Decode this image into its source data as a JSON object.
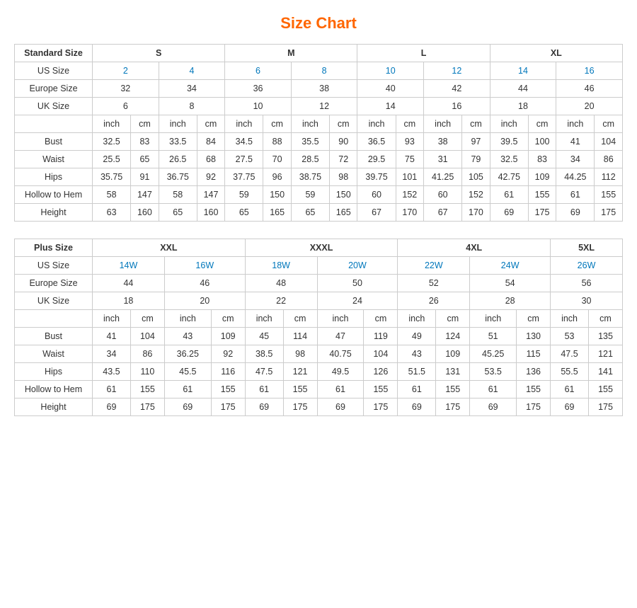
{
  "title": "Size Chart",
  "standard": {
    "section_title": "Standard Size",
    "sizes": [
      "S",
      "M",
      "L",
      "XL"
    ],
    "us_size_label": "US Size",
    "europe_size_label": "Europe Size",
    "uk_size_label": "UK Size",
    "us_sizes": [
      "2",
      "4",
      "6",
      "8",
      "10",
      "12",
      "14",
      "16"
    ],
    "europe_sizes": [
      "32",
      "34",
      "36",
      "38",
      "40",
      "42",
      "44",
      "46"
    ],
    "uk_sizes": [
      "6",
      "8",
      "10",
      "12",
      "14",
      "16",
      "18",
      "20"
    ],
    "inch_label": "inch",
    "cm_label": "cm",
    "measurements": [
      {
        "label": "Bust",
        "values": [
          "32.5",
          "83",
          "33.5",
          "84",
          "34.5",
          "88",
          "35.5",
          "90",
          "36.5",
          "93",
          "38",
          "97",
          "39.5",
          "100",
          "41",
          "104"
        ]
      },
      {
        "label": "Waist",
        "values": [
          "25.5",
          "65",
          "26.5",
          "68",
          "27.5",
          "70",
          "28.5",
          "72",
          "29.5",
          "75",
          "31",
          "79",
          "32.5",
          "83",
          "34",
          "86"
        ]
      },
      {
        "label": "Hips",
        "values": [
          "35.75",
          "91",
          "36.75",
          "92",
          "37.75",
          "96",
          "38.75",
          "98",
          "39.75",
          "101",
          "41.25",
          "105",
          "42.75",
          "109",
          "44.25",
          "112"
        ]
      },
      {
        "label": "Hollow to Hem",
        "values": [
          "58",
          "147",
          "58",
          "147",
          "59",
          "150",
          "59",
          "150",
          "60",
          "152",
          "60",
          "152",
          "61",
          "155",
          "61",
          "155"
        ]
      },
      {
        "label": "Height",
        "values": [
          "63",
          "160",
          "65",
          "160",
          "65",
          "165",
          "65",
          "165",
          "67",
          "170",
          "67",
          "170",
          "69",
          "175",
          "69",
          "175"
        ]
      }
    ]
  },
  "plus": {
    "section_title": "Plus Size",
    "sizes": [
      "XXL",
      "XXXL",
      "4XL",
      "5XL"
    ],
    "us_size_label": "US Size",
    "europe_size_label": "Europe Size",
    "uk_size_label": "UK Size",
    "us_sizes": [
      "14W",
      "16W",
      "18W",
      "20W",
      "22W",
      "24W",
      "26W"
    ],
    "europe_sizes": [
      "44",
      "46",
      "48",
      "50",
      "52",
      "54",
      "56"
    ],
    "uk_sizes": [
      "18",
      "20",
      "22",
      "24",
      "26",
      "28",
      "30"
    ],
    "inch_label": "inch",
    "cm_label": "cm",
    "measurements": [
      {
        "label": "Bust",
        "values": [
          "41",
          "104",
          "43",
          "109",
          "45",
          "114",
          "47",
          "119",
          "49",
          "124",
          "51",
          "130",
          "53",
          "135"
        ]
      },
      {
        "label": "Waist",
        "values": [
          "34",
          "86",
          "36.25",
          "92",
          "38.5",
          "98",
          "40.75",
          "104",
          "43",
          "109",
          "45.25",
          "115",
          "47.5",
          "121"
        ]
      },
      {
        "label": "Hips",
        "values": [
          "43.5",
          "110",
          "45.5",
          "116",
          "47.5",
          "121",
          "49.5",
          "126",
          "51.5",
          "131",
          "53.5",
          "136",
          "55.5",
          "141"
        ]
      },
      {
        "label": "Hollow to Hem",
        "values": [
          "61",
          "155",
          "61",
          "155",
          "61",
          "155",
          "61",
          "155",
          "61",
          "155",
          "61",
          "155",
          "61",
          "155"
        ]
      },
      {
        "label": "Height",
        "values": [
          "69",
          "175",
          "69",
          "175",
          "69",
          "175",
          "69",
          "175",
          "69",
          "175",
          "69",
          "175",
          "69",
          "175"
        ]
      }
    ]
  }
}
